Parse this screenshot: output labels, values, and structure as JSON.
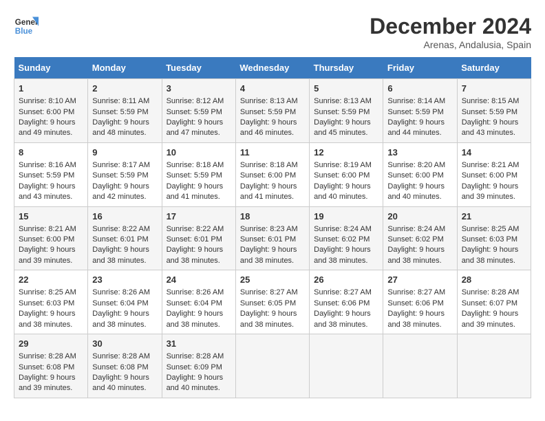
{
  "logo": {
    "line1": "General",
    "line2": "Blue"
  },
  "title": "December 2024",
  "subtitle": "Arenas, Andalusia, Spain",
  "days_header": [
    "Sunday",
    "Monday",
    "Tuesday",
    "Wednesday",
    "Thursday",
    "Friday",
    "Saturday"
  ],
  "weeks": [
    [
      {
        "day": "1",
        "sunrise": "Sunrise: 8:10 AM",
        "sunset": "Sunset: 6:00 PM",
        "daylight": "Daylight: 9 hours and 49 minutes."
      },
      {
        "day": "2",
        "sunrise": "Sunrise: 8:11 AM",
        "sunset": "Sunset: 5:59 PM",
        "daylight": "Daylight: 9 hours and 48 minutes."
      },
      {
        "day": "3",
        "sunrise": "Sunrise: 8:12 AM",
        "sunset": "Sunset: 5:59 PM",
        "daylight": "Daylight: 9 hours and 47 minutes."
      },
      {
        "day": "4",
        "sunrise": "Sunrise: 8:13 AM",
        "sunset": "Sunset: 5:59 PM",
        "daylight": "Daylight: 9 hours and 46 minutes."
      },
      {
        "day": "5",
        "sunrise": "Sunrise: 8:13 AM",
        "sunset": "Sunset: 5:59 PM",
        "daylight": "Daylight: 9 hours and 45 minutes."
      },
      {
        "day": "6",
        "sunrise": "Sunrise: 8:14 AM",
        "sunset": "Sunset: 5:59 PM",
        "daylight": "Daylight: 9 hours and 44 minutes."
      },
      {
        "day": "7",
        "sunrise": "Sunrise: 8:15 AM",
        "sunset": "Sunset: 5:59 PM",
        "daylight": "Daylight: 9 hours and 43 minutes."
      }
    ],
    [
      {
        "day": "8",
        "sunrise": "Sunrise: 8:16 AM",
        "sunset": "Sunset: 5:59 PM",
        "daylight": "Daylight: 9 hours and 43 minutes."
      },
      {
        "day": "9",
        "sunrise": "Sunrise: 8:17 AM",
        "sunset": "Sunset: 5:59 PM",
        "daylight": "Daylight: 9 hours and 42 minutes."
      },
      {
        "day": "10",
        "sunrise": "Sunrise: 8:18 AM",
        "sunset": "Sunset: 5:59 PM",
        "daylight": "Daylight: 9 hours and 41 minutes."
      },
      {
        "day": "11",
        "sunrise": "Sunrise: 8:18 AM",
        "sunset": "Sunset: 6:00 PM",
        "daylight": "Daylight: 9 hours and 41 minutes."
      },
      {
        "day": "12",
        "sunrise": "Sunrise: 8:19 AM",
        "sunset": "Sunset: 6:00 PM",
        "daylight": "Daylight: 9 hours and 40 minutes."
      },
      {
        "day": "13",
        "sunrise": "Sunrise: 8:20 AM",
        "sunset": "Sunset: 6:00 PM",
        "daylight": "Daylight: 9 hours and 40 minutes."
      },
      {
        "day": "14",
        "sunrise": "Sunrise: 8:21 AM",
        "sunset": "Sunset: 6:00 PM",
        "daylight": "Daylight: 9 hours and 39 minutes."
      }
    ],
    [
      {
        "day": "15",
        "sunrise": "Sunrise: 8:21 AM",
        "sunset": "Sunset: 6:00 PM",
        "daylight": "Daylight: 9 hours and 39 minutes."
      },
      {
        "day": "16",
        "sunrise": "Sunrise: 8:22 AM",
        "sunset": "Sunset: 6:01 PM",
        "daylight": "Daylight: 9 hours and 38 minutes."
      },
      {
        "day": "17",
        "sunrise": "Sunrise: 8:22 AM",
        "sunset": "Sunset: 6:01 PM",
        "daylight": "Daylight: 9 hours and 38 minutes."
      },
      {
        "day": "18",
        "sunrise": "Sunrise: 8:23 AM",
        "sunset": "Sunset: 6:01 PM",
        "daylight": "Daylight: 9 hours and 38 minutes."
      },
      {
        "day": "19",
        "sunrise": "Sunrise: 8:24 AM",
        "sunset": "Sunset: 6:02 PM",
        "daylight": "Daylight: 9 hours and 38 minutes."
      },
      {
        "day": "20",
        "sunrise": "Sunrise: 8:24 AM",
        "sunset": "Sunset: 6:02 PM",
        "daylight": "Daylight: 9 hours and 38 minutes."
      },
      {
        "day": "21",
        "sunrise": "Sunrise: 8:25 AM",
        "sunset": "Sunset: 6:03 PM",
        "daylight": "Daylight: 9 hours and 38 minutes."
      }
    ],
    [
      {
        "day": "22",
        "sunrise": "Sunrise: 8:25 AM",
        "sunset": "Sunset: 6:03 PM",
        "daylight": "Daylight: 9 hours and 38 minutes."
      },
      {
        "day": "23",
        "sunrise": "Sunrise: 8:26 AM",
        "sunset": "Sunset: 6:04 PM",
        "daylight": "Daylight: 9 hours and 38 minutes."
      },
      {
        "day": "24",
        "sunrise": "Sunrise: 8:26 AM",
        "sunset": "Sunset: 6:04 PM",
        "daylight": "Daylight: 9 hours and 38 minutes."
      },
      {
        "day": "25",
        "sunrise": "Sunrise: 8:27 AM",
        "sunset": "Sunset: 6:05 PM",
        "daylight": "Daylight: 9 hours and 38 minutes."
      },
      {
        "day": "26",
        "sunrise": "Sunrise: 8:27 AM",
        "sunset": "Sunset: 6:06 PM",
        "daylight": "Daylight: 9 hours and 38 minutes."
      },
      {
        "day": "27",
        "sunrise": "Sunrise: 8:27 AM",
        "sunset": "Sunset: 6:06 PM",
        "daylight": "Daylight: 9 hours and 38 minutes."
      },
      {
        "day": "28",
        "sunrise": "Sunrise: 8:28 AM",
        "sunset": "Sunset: 6:07 PM",
        "daylight": "Daylight: 9 hours and 39 minutes."
      }
    ],
    [
      {
        "day": "29",
        "sunrise": "Sunrise: 8:28 AM",
        "sunset": "Sunset: 6:08 PM",
        "daylight": "Daylight: 9 hours and 39 minutes."
      },
      {
        "day": "30",
        "sunrise": "Sunrise: 8:28 AM",
        "sunset": "Sunset: 6:08 PM",
        "daylight": "Daylight: 9 hours and 40 minutes."
      },
      {
        "day": "31",
        "sunrise": "Sunrise: 8:28 AM",
        "sunset": "Sunset: 6:09 PM",
        "daylight": "Daylight: 9 hours and 40 minutes."
      },
      null,
      null,
      null,
      null
    ]
  ]
}
